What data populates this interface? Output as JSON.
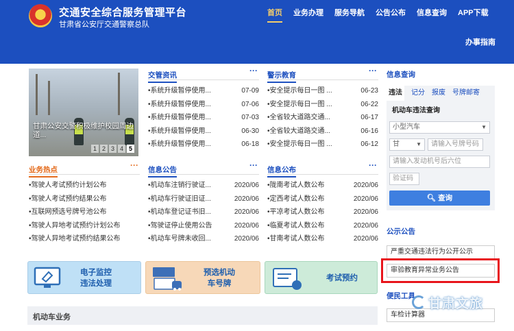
{
  "header": {
    "title": "交通安全综合服务管理平台",
    "subtitle": "甘肃省公安厅交通警察总队",
    "nav": [
      "首页",
      "业务办理",
      "服务导航",
      "公告公布",
      "信息查询",
      "APP下载"
    ],
    "guide": "办事指南"
  },
  "slider": {
    "caption": "甘肃公安交警积极维护校园周边道...",
    "pages": [
      "1",
      "2",
      "3",
      "4",
      "5"
    ],
    "active_page": 5
  },
  "traffic_news": {
    "title": "交管资讯",
    "more": "···",
    "items": [
      {
        "text": "•系统升级暂停使用...",
        "date": "07-09"
      },
      {
        "text": "•系统升级暂停使用...",
        "date": "07-06"
      },
      {
        "text": "•系统升级暂停使用...",
        "date": "07-03"
      },
      {
        "text": "•系统升级暂停使用...",
        "date": "06-30"
      },
      {
        "text": "•系统升级暂停使用...",
        "date": "06-18"
      }
    ]
  },
  "warning": {
    "title": "警示教育",
    "more": "···",
    "items": [
      {
        "text": "•安全提示每日一图 ...",
        "date": "06-23"
      },
      {
        "text": "•安全提示每日一图 ...",
        "date": "06-22"
      },
      {
        "text": "•全省较大道路交通...",
        "date": "06-17"
      },
      {
        "text": "•全省较大道路交通...",
        "date": "06-16"
      },
      {
        "text": "•安全提示每日一图 ...",
        "date": "06-12"
      }
    ]
  },
  "business_hot": {
    "title": "业务热点",
    "more": "···",
    "items": [
      "•驾驶人考试预约计划公布",
      "•驾驶人考试预约结果公布",
      "•互联网预选号牌号池公布",
      "•驾驶人异地考试预约计划公布",
      "•驾驶人异地考试预约结果公布"
    ]
  },
  "info_notice": {
    "title": "信息公告",
    "more": "···",
    "items": [
      {
        "text": "•机动车注销行驶证...",
        "date": "2020/06"
      },
      {
        "text": "•机动车行驶证旧证...",
        "date": "2020/06"
      },
      {
        "text": "•机动车登记证书旧...",
        "date": "2020/06"
      },
      {
        "text": "•驾驶证停止使用公告",
        "date": "2020/06"
      },
      {
        "text": "•机动车号牌未收回...",
        "date": "2020/06"
      }
    ]
  },
  "info_publish": {
    "title": "信息公布",
    "more": "···",
    "items": [
      {
        "text": "•陇南考试人数公布",
        "date": "2020/06"
      },
      {
        "text": "•定西考试人数公布",
        "date": "2020/06"
      },
      {
        "text": "•平凉考试人数公布",
        "date": "2020/06"
      },
      {
        "text": "•临夏考试人数公布",
        "date": "2020/06"
      },
      {
        "text": "•甘南考试人数公布",
        "date": "2020/06"
      }
    ]
  },
  "services": [
    {
      "line1": "电子监控",
      "line2": "违法处理",
      "icon": "monitor-icon"
    },
    {
      "line1": "预选机动",
      "line2": "车号牌",
      "icon": "license-plate-icon"
    },
    {
      "line1": "考试预约",
      "line2": "",
      "icon": "exam-icon"
    }
  ],
  "motor_business": "机动车业务",
  "query": {
    "title": "信息查询",
    "tabs": [
      "违法",
      "记分",
      "报废",
      "号牌邮寄"
    ],
    "active_tab": 0,
    "subtitle": "机动车违法查询",
    "vehicle_type": "小型汽车",
    "province": "甘",
    "plate_placeholder": "请输入号牌号码",
    "engine_placeholder": "请输入发动机号后六位",
    "captcha_placeholder": "验证码",
    "button": "查询"
  },
  "announcements": {
    "title": "公示公告",
    "items": [
      "严重交通违法行为公开公示",
      "审验教育异常业务公告"
    ]
  },
  "tools": {
    "title": "便民工具",
    "items": [
      "车检计算器"
    ]
  },
  "watermark": "甘肃文旅",
  "colors": {
    "brand": "#1c4fbf",
    "accent": "#f4cd6b",
    "orange": "#e46b1c",
    "highlight": "#e8141b"
  }
}
